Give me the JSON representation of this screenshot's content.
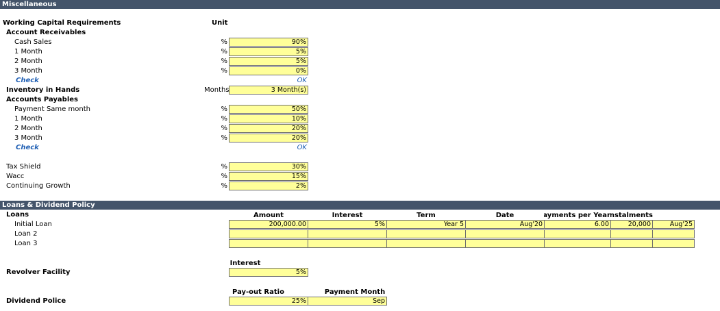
{
  "sections": {
    "misc": "Miscellaneous",
    "loans": "Loans & Dividend Policy"
  },
  "wc": {
    "title": "Working Capital Requirements",
    "unit_header": "Unit",
    "ar_title": "Account Receivables",
    "ar": [
      {
        "label": "Cash Sales",
        "unit": "%",
        "value": "90%"
      },
      {
        "label": "1 Month",
        "unit": "%",
        "value": "5%"
      },
      {
        "label": "2 Month",
        "unit": "%",
        "value": "5%"
      },
      {
        "label": "3 Month",
        "unit": "%",
        "value": "0%"
      }
    ],
    "check_label": "Check",
    "check_value": "OK",
    "inventory_label": "Inventory in Hands",
    "inventory_unit": "Months",
    "inventory_value": "3 Month(s)",
    "ap_title": "Accounts Payables",
    "ap": [
      {
        "label": "Payment Same month",
        "unit": "%",
        "value": "50%"
      },
      {
        "label": "1 Month",
        "unit": "%",
        "value": "10%"
      },
      {
        "label": "2 Month",
        "unit": "%",
        "value": "20%"
      },
      {
        "label": "3 Month",
        "unit": "%",
        "value": "20%"
      }
    ],
    "check2_label": "Check",
    "check2_value": "OK",
    "other": [
      {
        "label": "Tax Shield",
        "unit": "%",
        "value": "30%"
      },
      {
        "label": "Wacc",
        "unit": "%",
        "value": "15%"
      },
      {
        "label": "Continuing Growth",
        "unit": "%",
        "value": "2%"
      }
    ]
  },
  "loans": {
    "title": "Loans",
    "headers": {
      "amount": "Amount",
      "interest": "Interest",
      "term": "Term",
      "date": "Date",
      "payments": "Payments per Year",
      "instalments": "Instalments"
    },
    "rows": [
      {
        "label": "Initial Loan",
        "amount": "200,000.00",
        "interest": "5%",
        "term": "Year 5",
        "date": "Aug'20",
        "payments": "6.00",
        "instalment": "20,000",
        "end_date": "Aug'25"
      },
      {
        "label": "Loan 2",
        "amount": "",
        "interest": "",
        "term": "",
        "date": "",
        "payments": "",
        "instalment": "",
        "end_date": ""
      },
      {
        "label": "Loan 3",
        "amount": "",
        "interest": "",
        "term": "",
        "date": "",
        "payments": "",
        "instalment": "",
        "end_date": ""
      }
    ]
  },
  "revolver": {
    "interest_header": "Interest",
    "label": "Revolver Facility",
    "interest": "5%"
  },
  "dividend": {
    "ratio_header": "Pay-out Ratio",
    "month_header": "Payment Month",
    "label": "Dividend Police",
    "ratio": "25%",
    "month": "Sep"
  }
}
